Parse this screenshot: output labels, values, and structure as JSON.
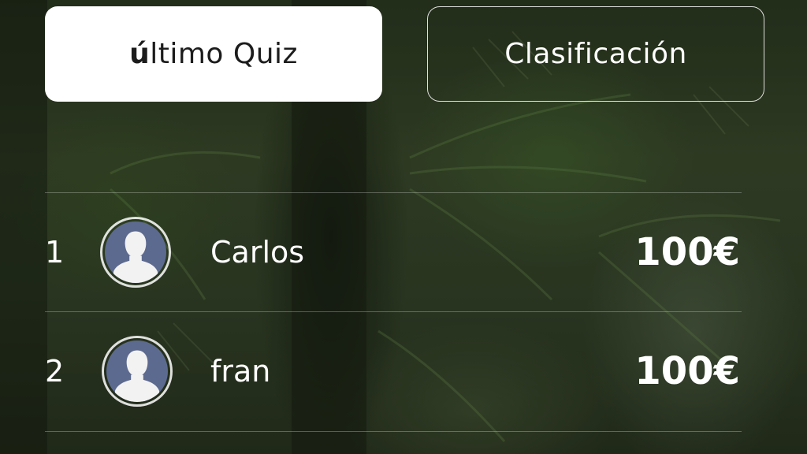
{
  "tabs": {
    "last_quiz": {
      "prefix": "ú",
      "rest": "ltimo Quiz"
    },
    "ranking": {
      "label": "Clasificación"
    }
  },
  "leaderboard": [
    {
      "rank": "1",
      "name": "Carlos",
      "score": "100€",
      "avatar_icon": "default-user-icon"
    },
    {
      "rank": "2",
      "name": "fran",
      "score": "100€",
      "avatar_icon": "default-user-icon"
    }
  ],
  "colors": {
    "active_tab_bg": "#ffffff",
    "avatar_bg": "#5d6a8f",
    "text": "#ffffff"
  }
}
